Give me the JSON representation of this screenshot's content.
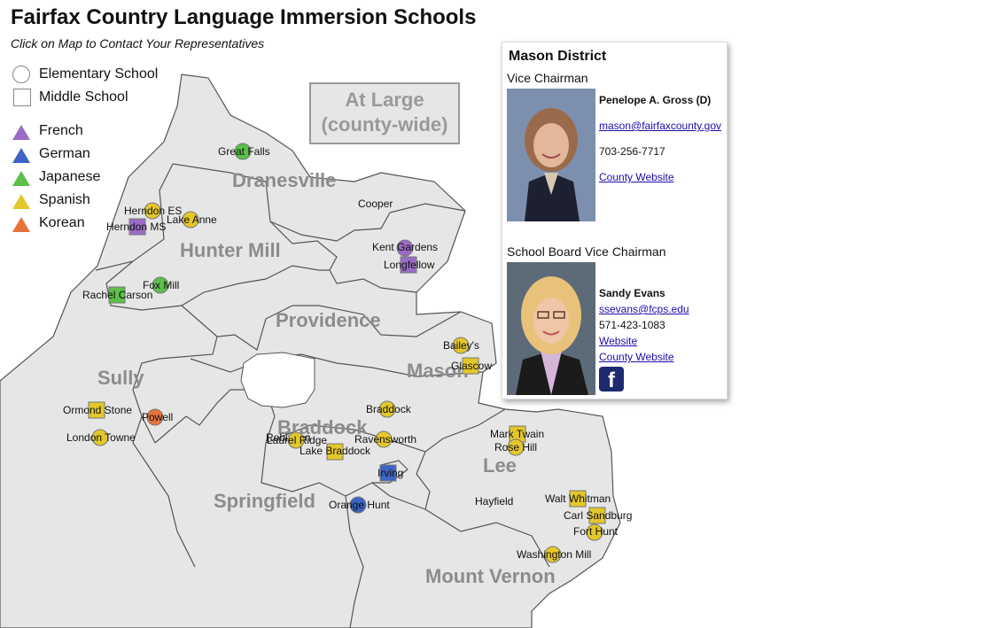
{
  "title": "Fairfax Country Language Immersion Schools",
  "subtitle": "Click on Map to Contact Your Representatives",
  "legend": {
    "shapes": [
      {
        "label": "Elementary School",
        "shape": "circle"
      },
      {
        "label": "Middle School",
        "shape": "square"
      }
    ],
    "languages": [
      {
        "label": "French",
        "color": "#9b6bc6"
      },
      {
        "label": "German",
        "color": "#3d64c4"
      },
      {
        "label": "Japanese",
        "color": "#5cbf4a"
      },
      {
        "label": "Spanish",
        "color": "#e3c72b"
      },
      {
        "label": "Korean",
        "color": "#e5733a"
      }
    ]
  },
  "at_large": {
    "line1": "At Large",
    "line2": "(county-wide)"
  },
  "districts": [
    "Dranesville",
    "Hunter Mill",
    "Providence",
    "Sully",
    "Mason",
    "Braddock",
    "Lee",
    "Springfield",
    "Mount Vernon"
  ],
  "schools": [
    {
      "name": "Great Falls",
      "type": "elementary",
      "language": "Japanese"
    },
    {
      "name": "Herndon ES",
      "type": "elementary",
      "language": "Spanish"
    },
    {
      "name": "Herndon MS",
      "type": "middle",
      "language": "French"
    },
    {
      "name": "Lake Anne",
      "type": "elementary",
      "language": "Spanish"
    },
    {
      "name": "Cooper",
      "type": "middle",
      "language": ""
    },
    {
      "name": "Kent Gardens",
      "type": "elementary",
      "language": "French"
    },
    {
      "name": "Longfellow",
      "type": "middle",
      "language": "French"
    },
    {
      "name": "Fox Mill",
      "type": "elementary",
      "language": "Japanese"
    },
    {
      "name": "Rachel Carson",
      "type": "middle",
      "language": "Japanese"
    },
    {
      "name": "Bailey's",
      "type": "elementary",
      "language": "Spanish"
    },
    {
      "name": "Glascow",
      "type": "middle",
      "language": "Spanish"
    },
    {
      "name": "Ormond Stone",
      "type": "middle",
      "language": "Spanish"
    },
    {
      "name": "Powell",
      "type": "elementary",
      "language": "Korean"
    },
    {
      "name": "London Towne",
      "type": "elementary",
      "language": "Spanish"
    },
    {
      "name": "Braddock",
      "type": "elementary",
      "language": "Spanish"
    },
    {
      "name": "Robinson",
      "type": "middle",
      "language": ""
    },
    {
      "name": "Laurel Ridge",
      "type": "elementary",
      "language": "Spanish"
    },
    {
      "name": "Ravensworth",
      "type": "elementary",
      "language": "Spanish"
    },
    {
      "name": "Lake Braddock",
      "type": "middle",
      "language": "Spanish"
    },
    {
      "name": "Irving",
      "type": "middle",
      "language": "German"
    },
    {
      "name": "Orange Hunt",
      "type": "elementary",
      "language": "German"
    },
    {
      "name": "Mark Twain",
      "type": "middle",
      "language": "Spanish"
    },
    {
      "name": "Rose Hill",
      "type": "elementary",
      "language": "Spanish"
    },
    {
      "name": "Hayfield",
      "type": "middle",
      "language": ""
    },
    {
      "name": "Walt Whitman",
      "type": "middle",
      "language": "Spanish"
    },
    {
      "name": "Carl Sandburg",
      "type": "middle",
      "language": "Spanish"
    },
    {
      "name": "Fort Hunt",
      "type": "elementary",
      "language": "Spanish"
    },
    {
      "name": "Washington Mill",
      "type": "elementary",
      "language": "Spanish"
    }
  ],
  "card": {
    "district": "Mason District",
    "rep1": {
      "role": "Vice Chairman",
      "name": "Penelope A. Gross (D)",
      "email": "mason@fairfaxcounty.gov",
      "phone": "703-256-7717",
      "county_link": "County Website"
    },
    "rep2": {
      "role": "School Board Vice Chairman",
      "name": "Sandy Evans",
      "email": "ssevans@fcps.edu",
      "phone": "571-423-1083",
      "website_link": "Website",
      "county_link": "County Website",
      "facebook_icon": "facebook-icon"
    }
  },
  "colors": {
    "map_fill": "#e6e6e6",
    "map_border": "#555555",
    "district_label": "#8c8c8c"
  }
}
